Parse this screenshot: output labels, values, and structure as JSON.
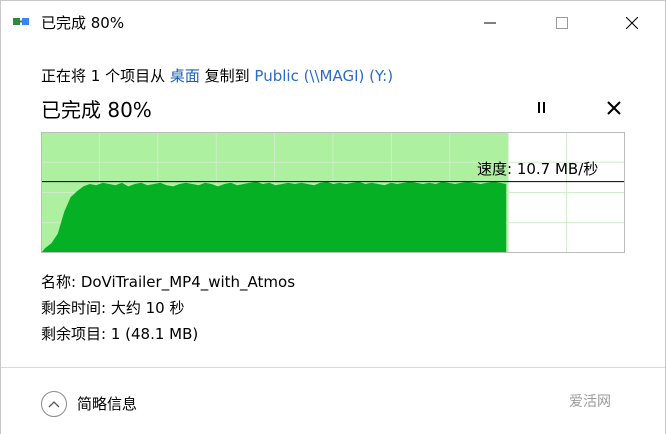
{
  "window": {
    "title": "已完成 80%"
  },
  "header": {
    "copy_prefix": "正在将 1 个项目从 ",
    "source": "桌面",
    "copy_middle": " 复制到 ",
    "destination": "Public (\\\\MAGI) (Y:)",
    "status": "已完成 80%"
  },
  "progress": {
    "fraction": 0.8
  },
  "speed": {
    "label": "速度: 10.7 MB/秒"
  },
  "chart_data": {
    "type": "area",
    "series": [
      {
        "values": [
          0.04,
          0.08,
          0.16,
          0.34,
          0.46,
          0.51,
          0.55,
          0.57,
          0.56,
          0.58,
          0.57,
          0.56,
          0.58,
          0.55,
          0.57,
          0.58,
          0.56,
          0.57,
          0.58,
          0.56,
          0.55,
          0.57,
          0.58,
          0.57,
          0.56,
          0.58,
          0.57,
          0.55,
          0.57,
          0.58,
          0.56,
          0.57,
          0.58,
          0.59,
          0.57,
          0.58,
          0.56,
          0.57,
          0.58,
          0.57,
          0.58,
          0.57,
          0.56,
          0.58,
          0.59,
          0.57,
          0.58,
          0.57,
          0.58,
          0.59,
          0.57,
          0.58,
          0.57,
          0.56,
          0.58,
          0.57,
          0.58,
          0.59,
          0.58,
          0.57,
          0.58,
          0.57,
          0.59,
          0.58,
          0.57,
          0.58,
          0.59,
          0.58,
          0.57,
          0.58,
          0.59,
          0.58,
          0.57
        ]
      }
    ],
    "current_speed_level": 0.59,
    "progress_fraction": 0.8,
    "ylim": [
      0,
      1
    ]
  },
  "info": {
    "name_label": "名称: ",
    "name_value": "DoViTrailer_MP4_with_Atmos",
    "time_label": "剩余时间: ",
    "time_value": "大约 10 秒",
    "items_label": "剩余项目: ",
    "items_value": "1 (48.1 MB)"
  },
  "footer": {
    "details_label": "简略信息"
  },
  "watermark": {
    "text": "爱活网"
  },
  "colors": {
    "progress_fill": "#acf0a0",
    "area_fill": "#06b025",
    "link": "#1a5fb4",
    "grid": "#ffffff"
  },
  "icons": {
    "title": "copy-progress-icon",
    "minimize": "minimize-icon",
    "maximize": "maximize-icon",
    "close": "close-icon",
    "pause": "pause-icon",
    "cancel": "cancel-icon",
    "details": "chevron-up-icon"
  }
}
